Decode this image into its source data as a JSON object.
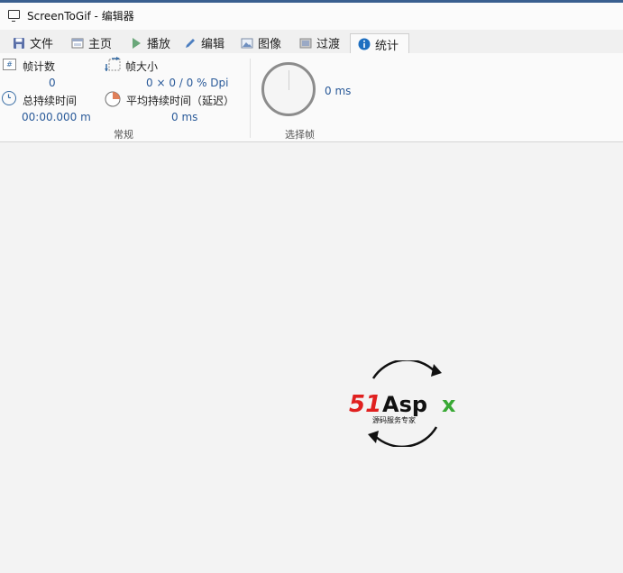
{
  "window": {
    "title": "ScreenToGif - 编辑器"
  },
  "tabs": [
    {
      "label": "文件",
      "icon": "save-icon"
    },
    {
      "label": "主页",
      "icon": "home-icon"
    },
    {
      "label": "播放",
      "icon": "play-icon"
    },
    {
      "label": "编辑",
      "icon": "pencil-icon"
    },
    {
      "label": "图像",
      "icon": "image-icon"
    },
    {
      "label": "过渡",
      "icon": "transition-icon"
    },
    {
      "label": "统计",
      "icon": "info-icon",
      "active": true
    }
  ],
  "stats": {
    "frame_count_label": "帧计数",
    "frame_count_value": "0",
    "frame_size_label": "帧大小",
    "frame_size_value": "0 × 0 / 0 % Dpi",
    "total_duration_label": "总持续时间",
    "total_duration_value": "00:00.000 m",
    "avg_duration_label": "平均持续时间（延迟）",
    "avg_duration_value": "0 ms",
    "group_general": "常规",
    "selected_frame_value": "0 ms",
    "group_selected": "选择帧"
  },
  "watermark": {
    "brand": "51Aspx",
    "tagline": "源码服务专家"
  },
  "colors": {
    "accent": "#2a5a99",
    "info_blue": "#1e6fc0",
    "brand_red": "#e0201f",
    "brand_green": "#39a935"
  }
}
